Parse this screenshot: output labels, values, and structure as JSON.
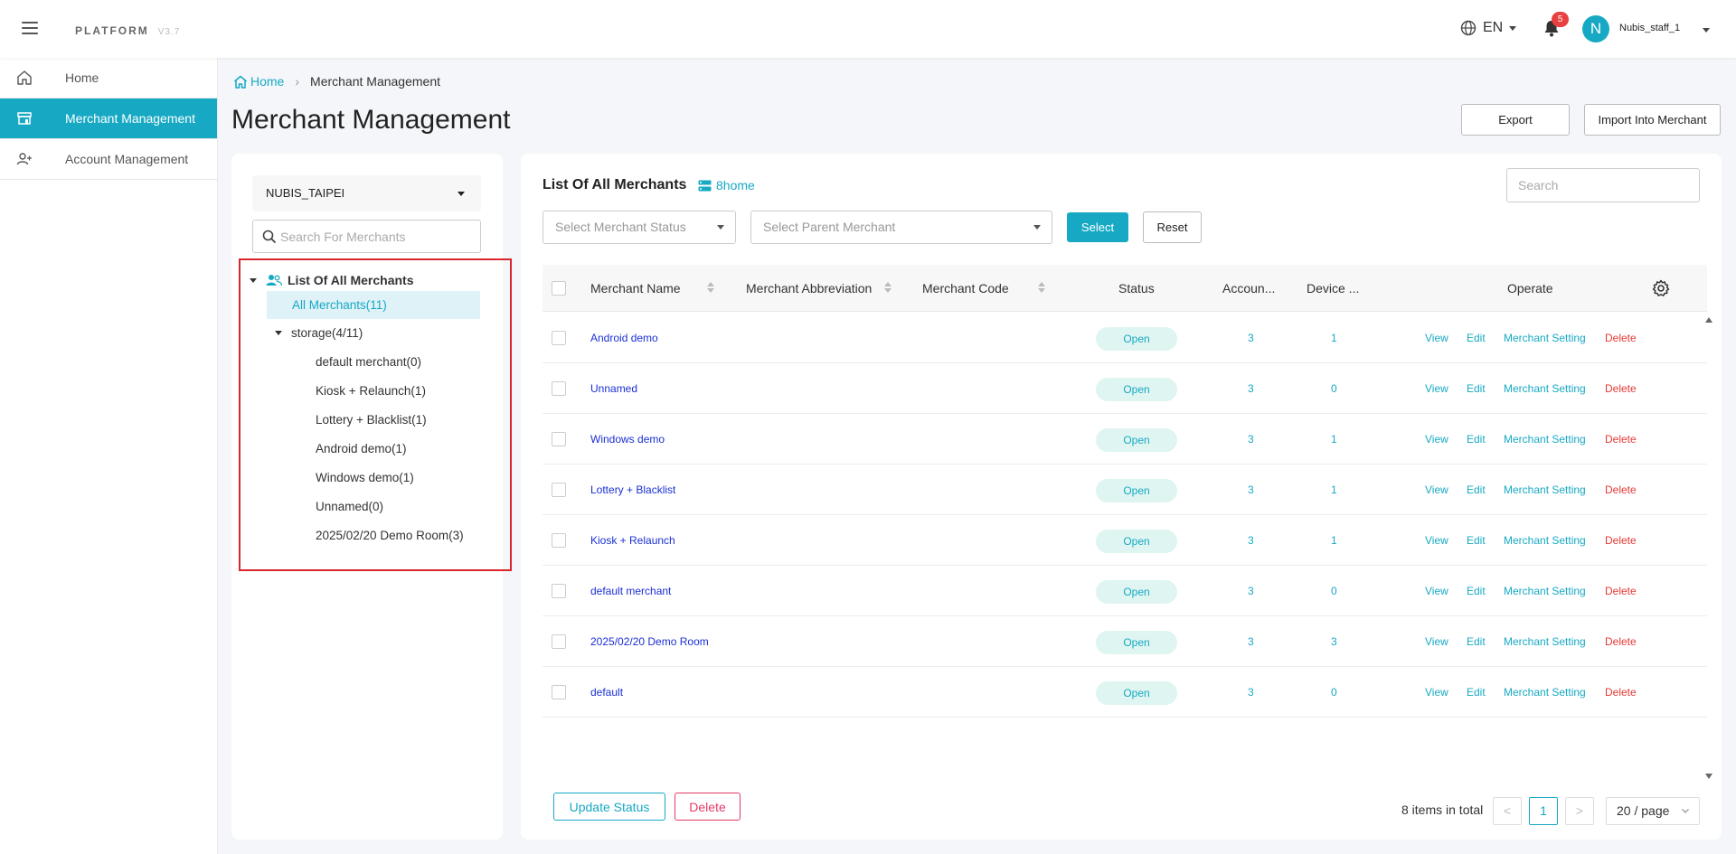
{
  "app": {
    "brand": "PLATFORM",
    "version": "V3.7"
  },
  "header": {
    "language": "EN",
    "notification_count": "5",
    "avatar_initial": "N",
    "username": "Nubis_staff_1"
  },
  "sidebar": {
    "items": [
      {
        "label": "Home",
        "icon": "home-icon"
      },
      {
        "label": "Merchant Management",
        "icon": "store-icon",
        "active": true
      },
      {
        "label": "Account Management",
        "icon": "users-icon"
      }
    ]
  },
  "breadcrumb": {
    "home": "Home",
    "current": "Merchant Management"
  },
  "page": {
    "title": "Merchant Management",
    "export_label": "Export",
    "import_label": "Import Into Merchant"
  },
  "tree": {
    "org_select": "NUBIS_TAIPEI",
    "search_placeholder": "Search For Merchants",
    "root": "List Of All Merchants",
    "all": "All Merchants(11)",
    "storage": "storage(4/11)",
    "children": [
      "default merchant(0)",
      "Kiosk + Relaunch(1)",
      "Lottery + Blacklist(1)",
      "Android demo(1)",
      "Windows demo(1)",
      "Unnamed(0)",
      "2025/02/20 Demo Room(3)"
    ]
  },
  "list": {
    "title": "List Of All Merchants",
    "home_tag": "8home",
    "search_placeholder": "Search",
    "status_placeholder": "Select Merchant Status",
    "parent_placeholder": "Select Parent Merchant",
    "select_label": "Select",
    "reset_label": "Reset",
    "columns": {
      "name": "Merchant Name",
      "abbr": "Merchant Abbreviation",
      "code": "Merchant Code",
      "status": "Status",
      "accounts": "Accoun...",
      "devices": "Device ...",
      "operate": "Operate"
    },
    "rows": [
      {
        "name": "Android demo",
        "status": "Open",
        "accounts": "3",
        "devices": "1"
      },
      {
        "name": "Unnamed",
        "status": "Open",
        "accounts": "3",
        "devices": "0"
      },
      {
        "name": "Windows demo",
        "status": "Open",
        "accounts": "3",
        "devices": "1"
      },
      {
        "name": "Lottery + Blacklist",
        "status": "Open",
        "accounts": "3",
        "devices": "1"
      },
      {
        "name": "Kiosk + Relaunch",
        "status": "Open",
        "accounts": "3",
        "devices": "1"
      },
      {
        "name": "default merchant",
        "status": "Open",
        "accounts": "3",
        "devices": "0"
      },
      {
        "name": "2025/02/20 Demo Room",
        "status": "Open",
        "accounts": "3",
        "devices": "3"
      },
      {
        "name": "default",
        "status": "Open",
        "accounts": "3",
        "devices": "0"
      }
    ],
    "ops": {
      "view": "View",
      "edit": "Edit",
      "setting": "Merchant Setting",
      "delete": "Delete"
    }
  },
  "footer": {
    "update_label": "Update Status",
    "delete_label": "Delete",
    "total": "8 items in total",
    "prev": "<",
    "page": "1",
    "next": ">",
    "page_size": "20 / page"
  },
  "colors": {
    "accent": "#17a9c4",
    "danger": "#e53935",
    "link": "#1a2fd4",
    "highlight_border": "#d9262c"
  }
}
